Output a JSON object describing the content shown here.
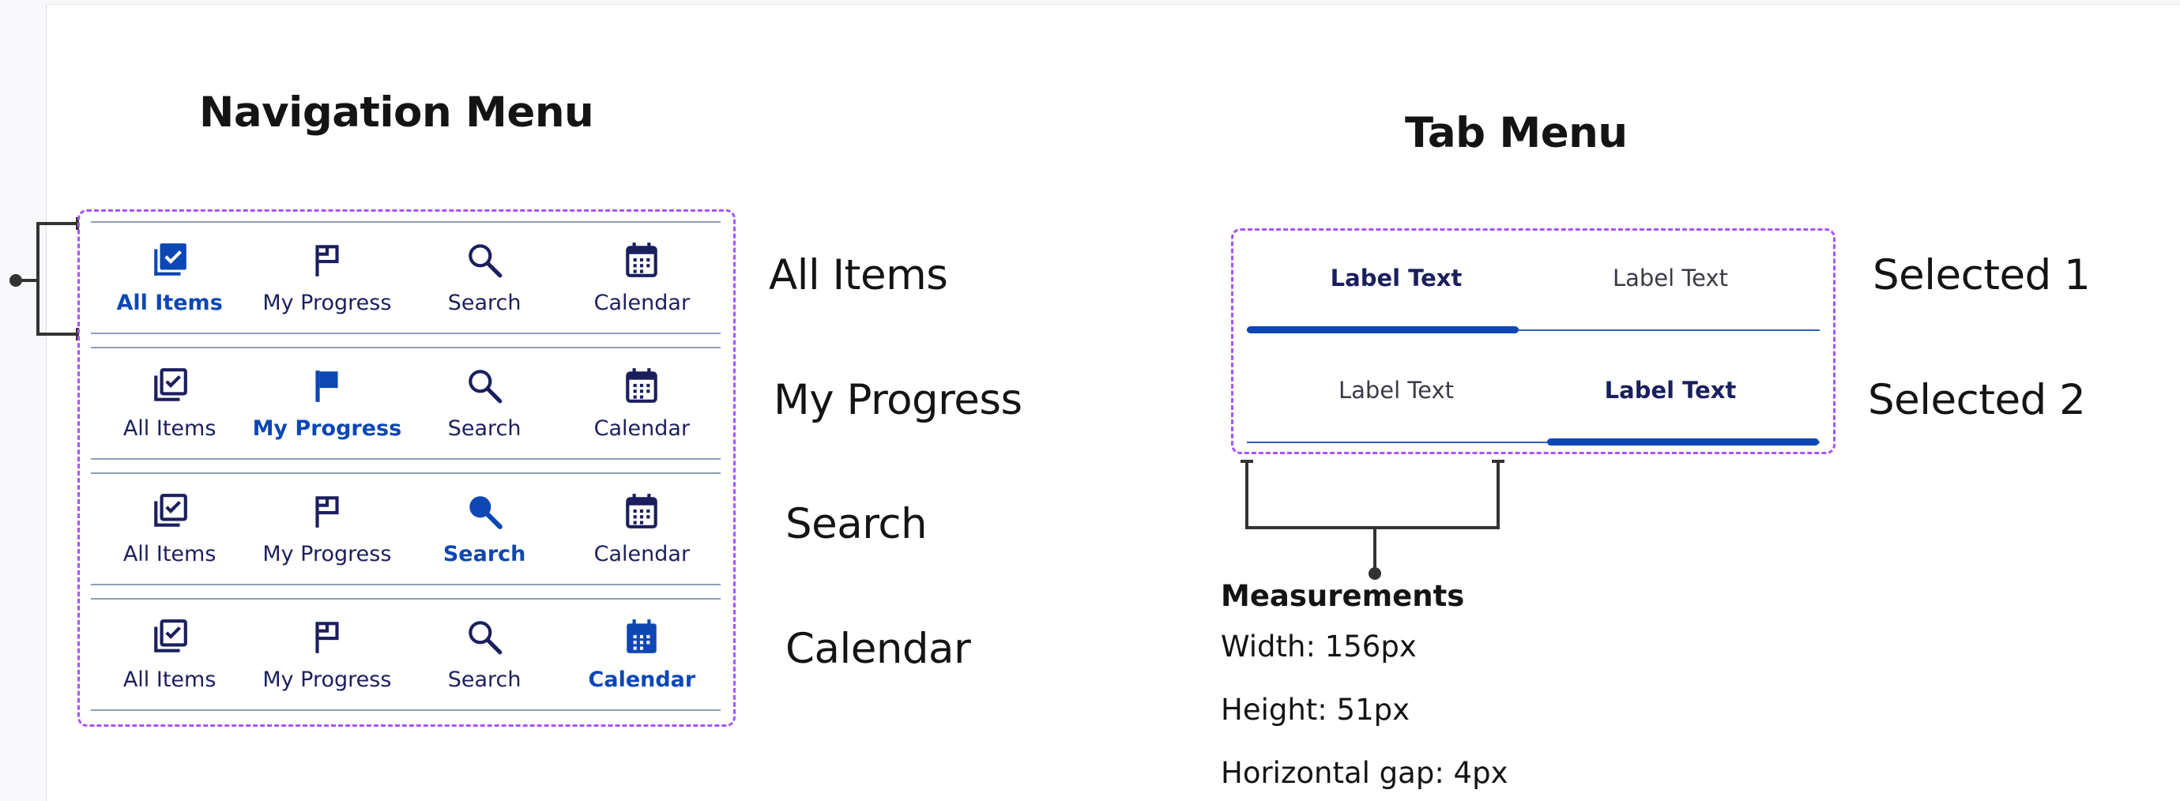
{
  "headings": {
    "navigation": "Navigation Menu",
    "tabs": "Tab Menu"
  },
  "nav_states": [
    {
      "state_label": "All Items",
      "active": 0,
      "items": [
        {
          "label": "All Items",
          "icon": "checklist-icon"
        },
        {
          "label": "My Progress",
          "icon": "flag-icon"
        },
        {
          "label": "Search",
          "icon": "search-icon"
        },
        {
          "label": "Calendar",
          "icon": "calendar-icon"
        }
      ]
    },
    {
      "state_label": "My Progress",
      "active": 1,
      "items": [
        {
          "label": "All Items",
          "icon": "checklist-icon"
        },
        {
          "label": "My Progress",
          "icon": "flag-icon"
        },
        {
          "label": "Search",
          "icon": "search-icon"
        },
        {
          "label": "Calendar",
          "icon": "calendar-icon"
        }
      ]
    },
    {
      "state_label": "Search",
      "active": 2,
      "items": [
        {
          "label": "All Items",
          "icon": "checklist-icon"
        },
        {
          "label": "My Progress",
          "icon": "flag-icon"
        },
        {
          "label": "Search",
          "icon": "search-icon"
        },
        {
          "label": "Calendar",
          "icon": "calendar-icon"
        }
      ]
    },
    {
      "state_label": "Calendar",
      "active": 3,
      "items": [
        {
          "label": "All Items",
          "icon": "checklist-icon"
        },
        {
          "label": "My Progress",
          "icon": "flag-icon"
        },
        {
          "label": "Search",
          "icon": "search-icon"
        },
        {
          "label": "Calendar",
          "icon": "calendar-icon"
        }
      ]
    }
  ],
  "tab_states": [
    {
      "state_label": "Selected 1",
      "active": 0,
      "tabs": [
        "Label Text",
        "Label Text"
      ]
    },
    {
      "state_label": "Selected 2",
      "active": 1,
      "tabs": [
        "Label Text",
        "Label Text"
      ]
    }
  ],
  "measurements": {
    "title": "Measurements",
    "width": "Width: 156px",
    "height": "Height: 51px",
    "gap": "Horizontal gap: 4px"
  },
  "colors": {
    "accent": "#0d47b4",
    "icon_default": "#1b1f5e",
    "dashed_outline": "#a855f7",
    "divider": "#8f9cb8"
  }
}
